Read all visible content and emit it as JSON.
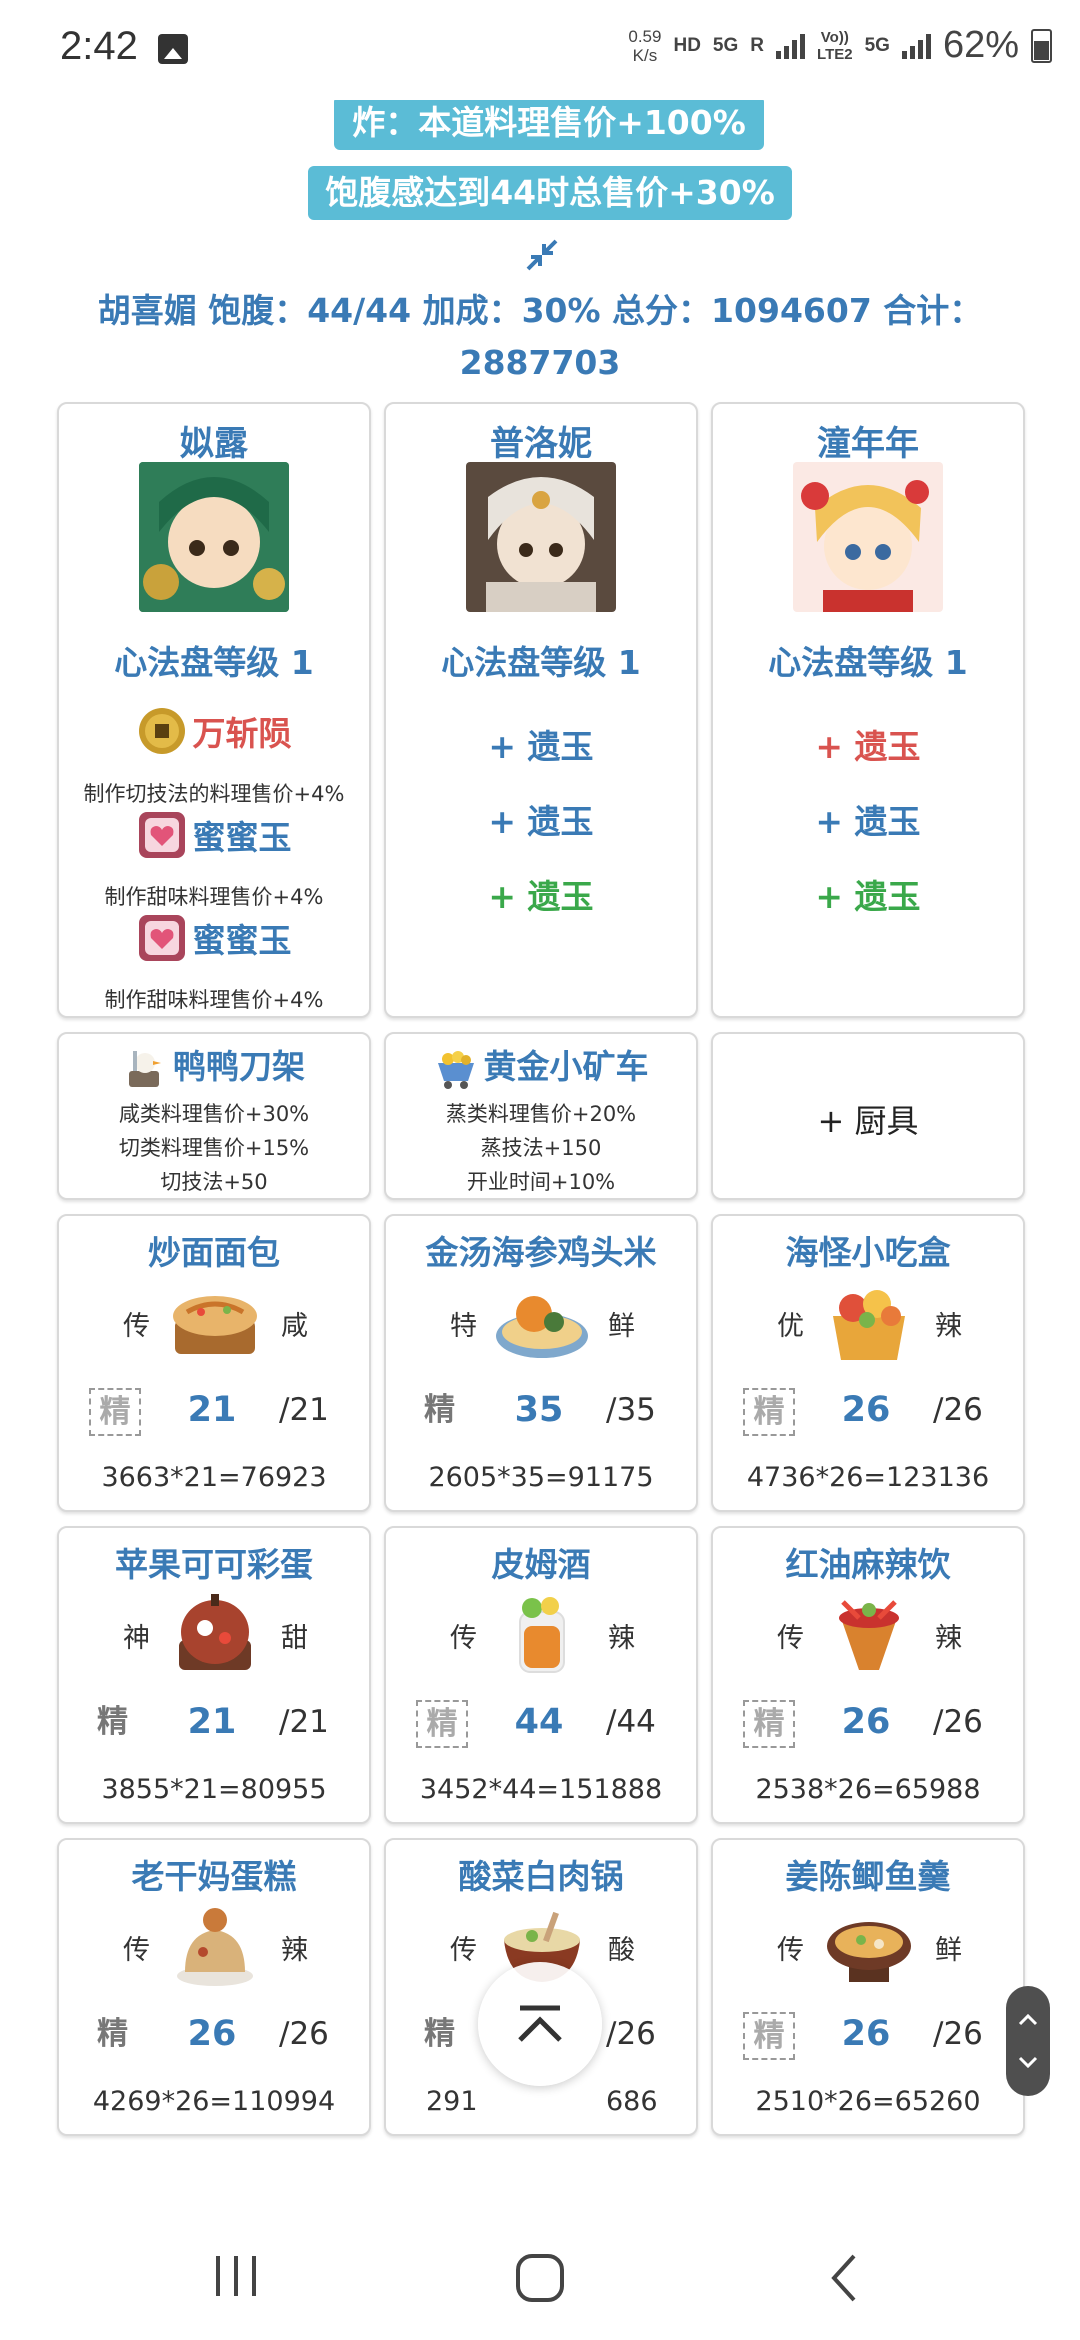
{
  "status_bar": {
    "time": "2:42",
    "net_speed_value": "0.59",
    "net_speed_unit": "K/s",
    "hd": "HD",
    "fiveg": "5G",
    "r": "R",
    "volte_top": "Vo))",
    "volte_bottom": "LTE2",
    "fiveg2": "5G",
    "battery": "62%"
  },
  "banners": {
    "fry": "炸：本道料理售价+100%",
    "fullness": "饱腹感达到44时总售价+30%"
  },
  "summary": {
    "line1": "胡喜媚 饱腹：44/44 加成：30% 总分：1094607 合计：",
    "line2": "2887703"
  },
  "chefs": [
    {
      "name": "姒露",
      "level": "心法盘等级 1",
      "jade1_name": "万斩陨",
      "jade1_desc": "制作切技法的料理售价+4%",
      "jade2_name": "蜜蜜玉",
      "jade2_desc": "制作甜味料理售价+4%",
      "jade3_name": "蜜蜜玉",
      "jade3_desc": "制作甜味料理售价+4%"
    },
    {
      "name": "普洛妮",
      "level": "心法盘等级 1",
      "slot1": "+ 遗玉",
      "slot2": "+ 遗玉",
      "slot3": "+ 遗玉"
    },
    {
      "name": "潼年年",
      "level": "心法盘等级 1",
      "slot1": "+ 遗玉",
      "slot2": "+ 遗玉",
      "slot3": "+ 遗玉"
    }
  ],
  "slot_colors": {
    "red": "#d9534f",
    "blue": "#3a7ab5",
    "green": "#3aa84a"
  },
  "tools": [
    {
      "name": "鸭鸭刀架",
      "line1": "咸类料理售价+30%",
      "line2": "切类料理售价+15%",
      "line3": "切技法+50"
    },
    {
      "name": "黄金小矿车",
      "line1": "蒸类料理售价+20%",
      "line2": "蒸技法+150",
      "line3": "开业时间+10%"
    },
    {
      "name": "+ 厨具"
    }
  ],
  "dishes": [
    {
      "name": "炒面面包",
      "rarity": "传",
      "flavor": "咸",
      "rank": "精",
      "count": "21",
      "max": "/21",
      "calc": "3663*21=76923"
    },
    {
      "name": "金汤海参鸡头米",
      "rarity": "特",
      "flavor": "鲜",
      "rank": "精",
      "count": "35",
      "max": "/35",
      "calc": "2605*35=91175"
    },
    {
      "name": "海怪小吃盒",
      "rarity": "优",
      "flavor": "辣",
      "rank": "精",
      "count": "26",
      "max": "/26",
      "calc": "4736*26=123136"
    },
    {
      "name": "苹果可可彩蛋",
      "rarity": "神",
      "flavor": "甜",
      "rank": "精",
      "count": "21",
      "max": "/21",
      "calc": "3855*21=80955"
    },
    {
      "name": "皮姆酒",
      "rarity": "传",
      "flavor": "辣",
      "rank": "精",
      "count": "44",
      "max": "/44",
      "calc": "3452*44=151888"
    },
    {
      "name": "红油麻辣饮",
      "rarity": "传",
      "flavor": "辣",
      "rank": "精",
      "count": "26",
      "max": "/26",
      "calc": "2538*26=65988"
    },
    {
      "name": "老干妈蛋糕",
      "rarity": "传",
      "flavor": "辣",
      "rank": "精",
      "count": "26",
      "max": "/26",
      "calc": "4269*26=110994"
    },
    {
      "name": "酸菜白肉锅",
      "rarity": "传",
      "flavor": "酸",
      "rank": "精",
      "count": "",
      "max": "/26",
      "calc_left": "291",
      "calc_right": "686"
    },
    {
      "name": "姜陈鲫鱼羹",
      "rarity": "传",
      "flavor": "鲜",
      "rank": "精",
      "count": "26",
      "max": "/26",
      "calc": "2510*26=65260"
    }
  ]
}
